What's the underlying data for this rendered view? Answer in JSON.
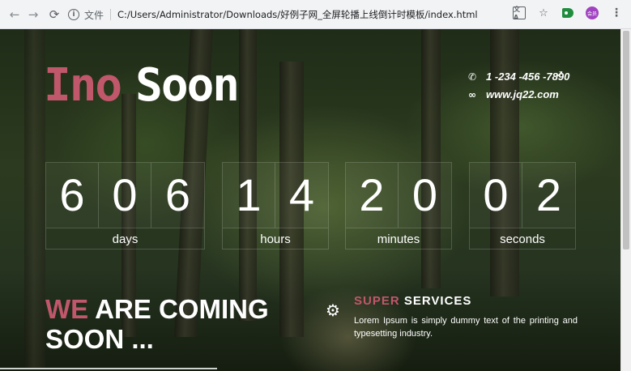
{
  "browser": {
    "back_icon": "←",
    "forward_icon": "→",
    "reload_icon": "⟳",
    "info_icon": "i",
    "file_label": "文件",
    "url": "C:/Users/Administrator/Downloads/好例子网_全屏轮播上线倒计时模板/index.html",
    "translate_icon": "文A",
    "star_icon": "☆",
    "avatar_text": "会员",
    "menu_icon": "⋮"
  },
  "logo": {
    "part1": "Ino",
    "part2": "Soon"
  },
  "contact": {
    "phone_icon": "✆",
    "phone": "1 -234 -456 -7890",
    "link_icon": "∞",
    "website": "www.jq22.com"
  },
  "countdown": [
    {
      "digits": [
        "6",
        "0",
        "6"
      ],
      "unit": "days"
    },
    {
      "digits": [
        "1",
        "4"
      ],
      "unit": "hours"
    },
    {
      "digits": [
        "2",
        "0"
      ],
      "unit": "minutes"
    },
    {
      "digits": [
        "0",
        "2"
      ],
      "unit": "seconds"
    }
  ],
  "headline": {
    "accent": "WE",
    "line1_rest": " ARE COMING",
    "line2": "SOON ..."
  },
  "services": {
    "gear_icon": "⚙",
    "title_accent": "SUPER",
    "title_rest": " SERVICES",
    "text": "Lorem Ipsum is simply dummy text of the printing and typesetting industry."
  },
  "colors": {
    "accent": "#c0576b",
    "text": "#ffffff"
  }
}
